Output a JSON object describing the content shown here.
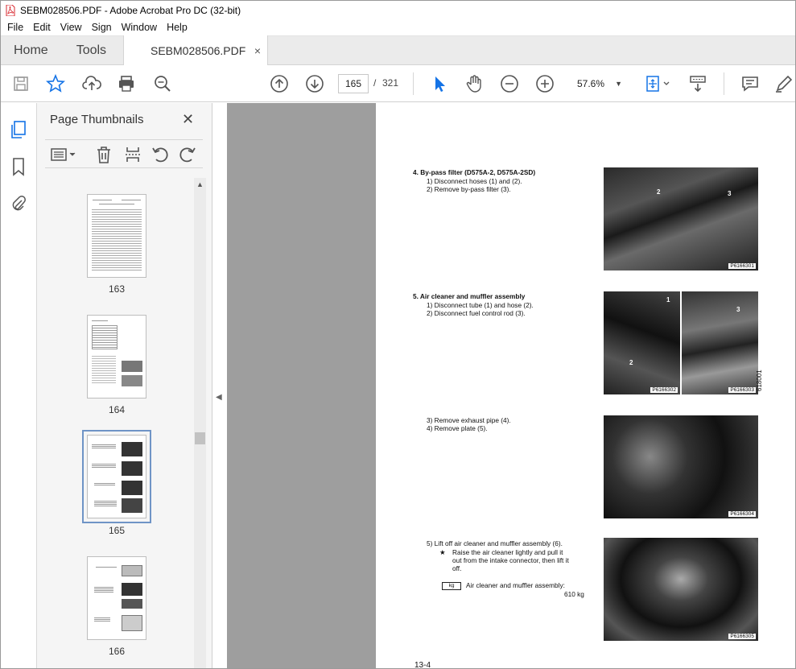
{
  "window": {
    "title": "SEBM028506.PDF - Adobe Acrobat Pro DC (32-bit)"
  },
  "menu": [
    "File",
    "Edit",
    "View",
    "Sign",
    "Window",
    "Help"
  ],
  "tabs": {
    "home": "Home",
    "tools": "Tools",
    "document": "SEBM028506.PDF",
    "close_glyph": "×"
  },
  "toolbar": {
    "current_page": "165",
    "page_separator": "/",
    "total_pages": "321",
    "zoom": "57.6%",
    "zoom_caret": "▼"
  },
  "thumbnails_panel": {
    "title": "Page Thumbnails",
    "close_glyph": "✕",
    "thumbnails": [
      {
        "label": "163",
        "selected": false
      },
      {
        "label": "164",
        "selected": false
      },
      {
        "label": "165",
        "selected": true
      },
      {
        "label": "166",
        "selected": false
      }
    ]
  },
  "document_page": {
    "sections": [
      {
        "heading": "4.   By-pass filter (D575A-2, D575A-2SD)",
        "steps": [
          "1)   Disconnect hoses (1) and (2).",
          "2)   Remove by-pass filter (3)."
        ]
      },
      {
        "heading": "5.   Air cleaner and muffler assembly",
        "steps": [
          "1)   Disconnect tube (1) and hose (2).",
          "2)   Disconnect fuel control rod (3)."
        ]
      },
      {
        "heading": "",
        "steps": [
          "3)   Remove exhaust pipe (4).",
          "4)   Remove plate (5)."
        ]
      },
      {
        "heading": "",
        "steps": [
          "5)   Lift off air cleaner and muffler assembly (6)."
        ]
      }
    ],
    "note_star": "★",
    "note_lines": [
      "Raise the air cleaner lightly and pull it",
      "out from the intake connector, then lift it",
      "off."
    ],
    "weight_unit": "kg",
    "weight_label": "Air cleaner and muffler assembly:",
    "weight_value": "610 kg",
    "photo_labels": [
      "P6166301",
      "P6166302",
      "P6166303",
      "P6166304",
      "P6166305"
    ],
    "callouts": [
      "2",
      "3",
      "1",
      "2",
      "3"
    ],
    "side_code": "618001",
    "page_footer": "13-4"
  }
}
